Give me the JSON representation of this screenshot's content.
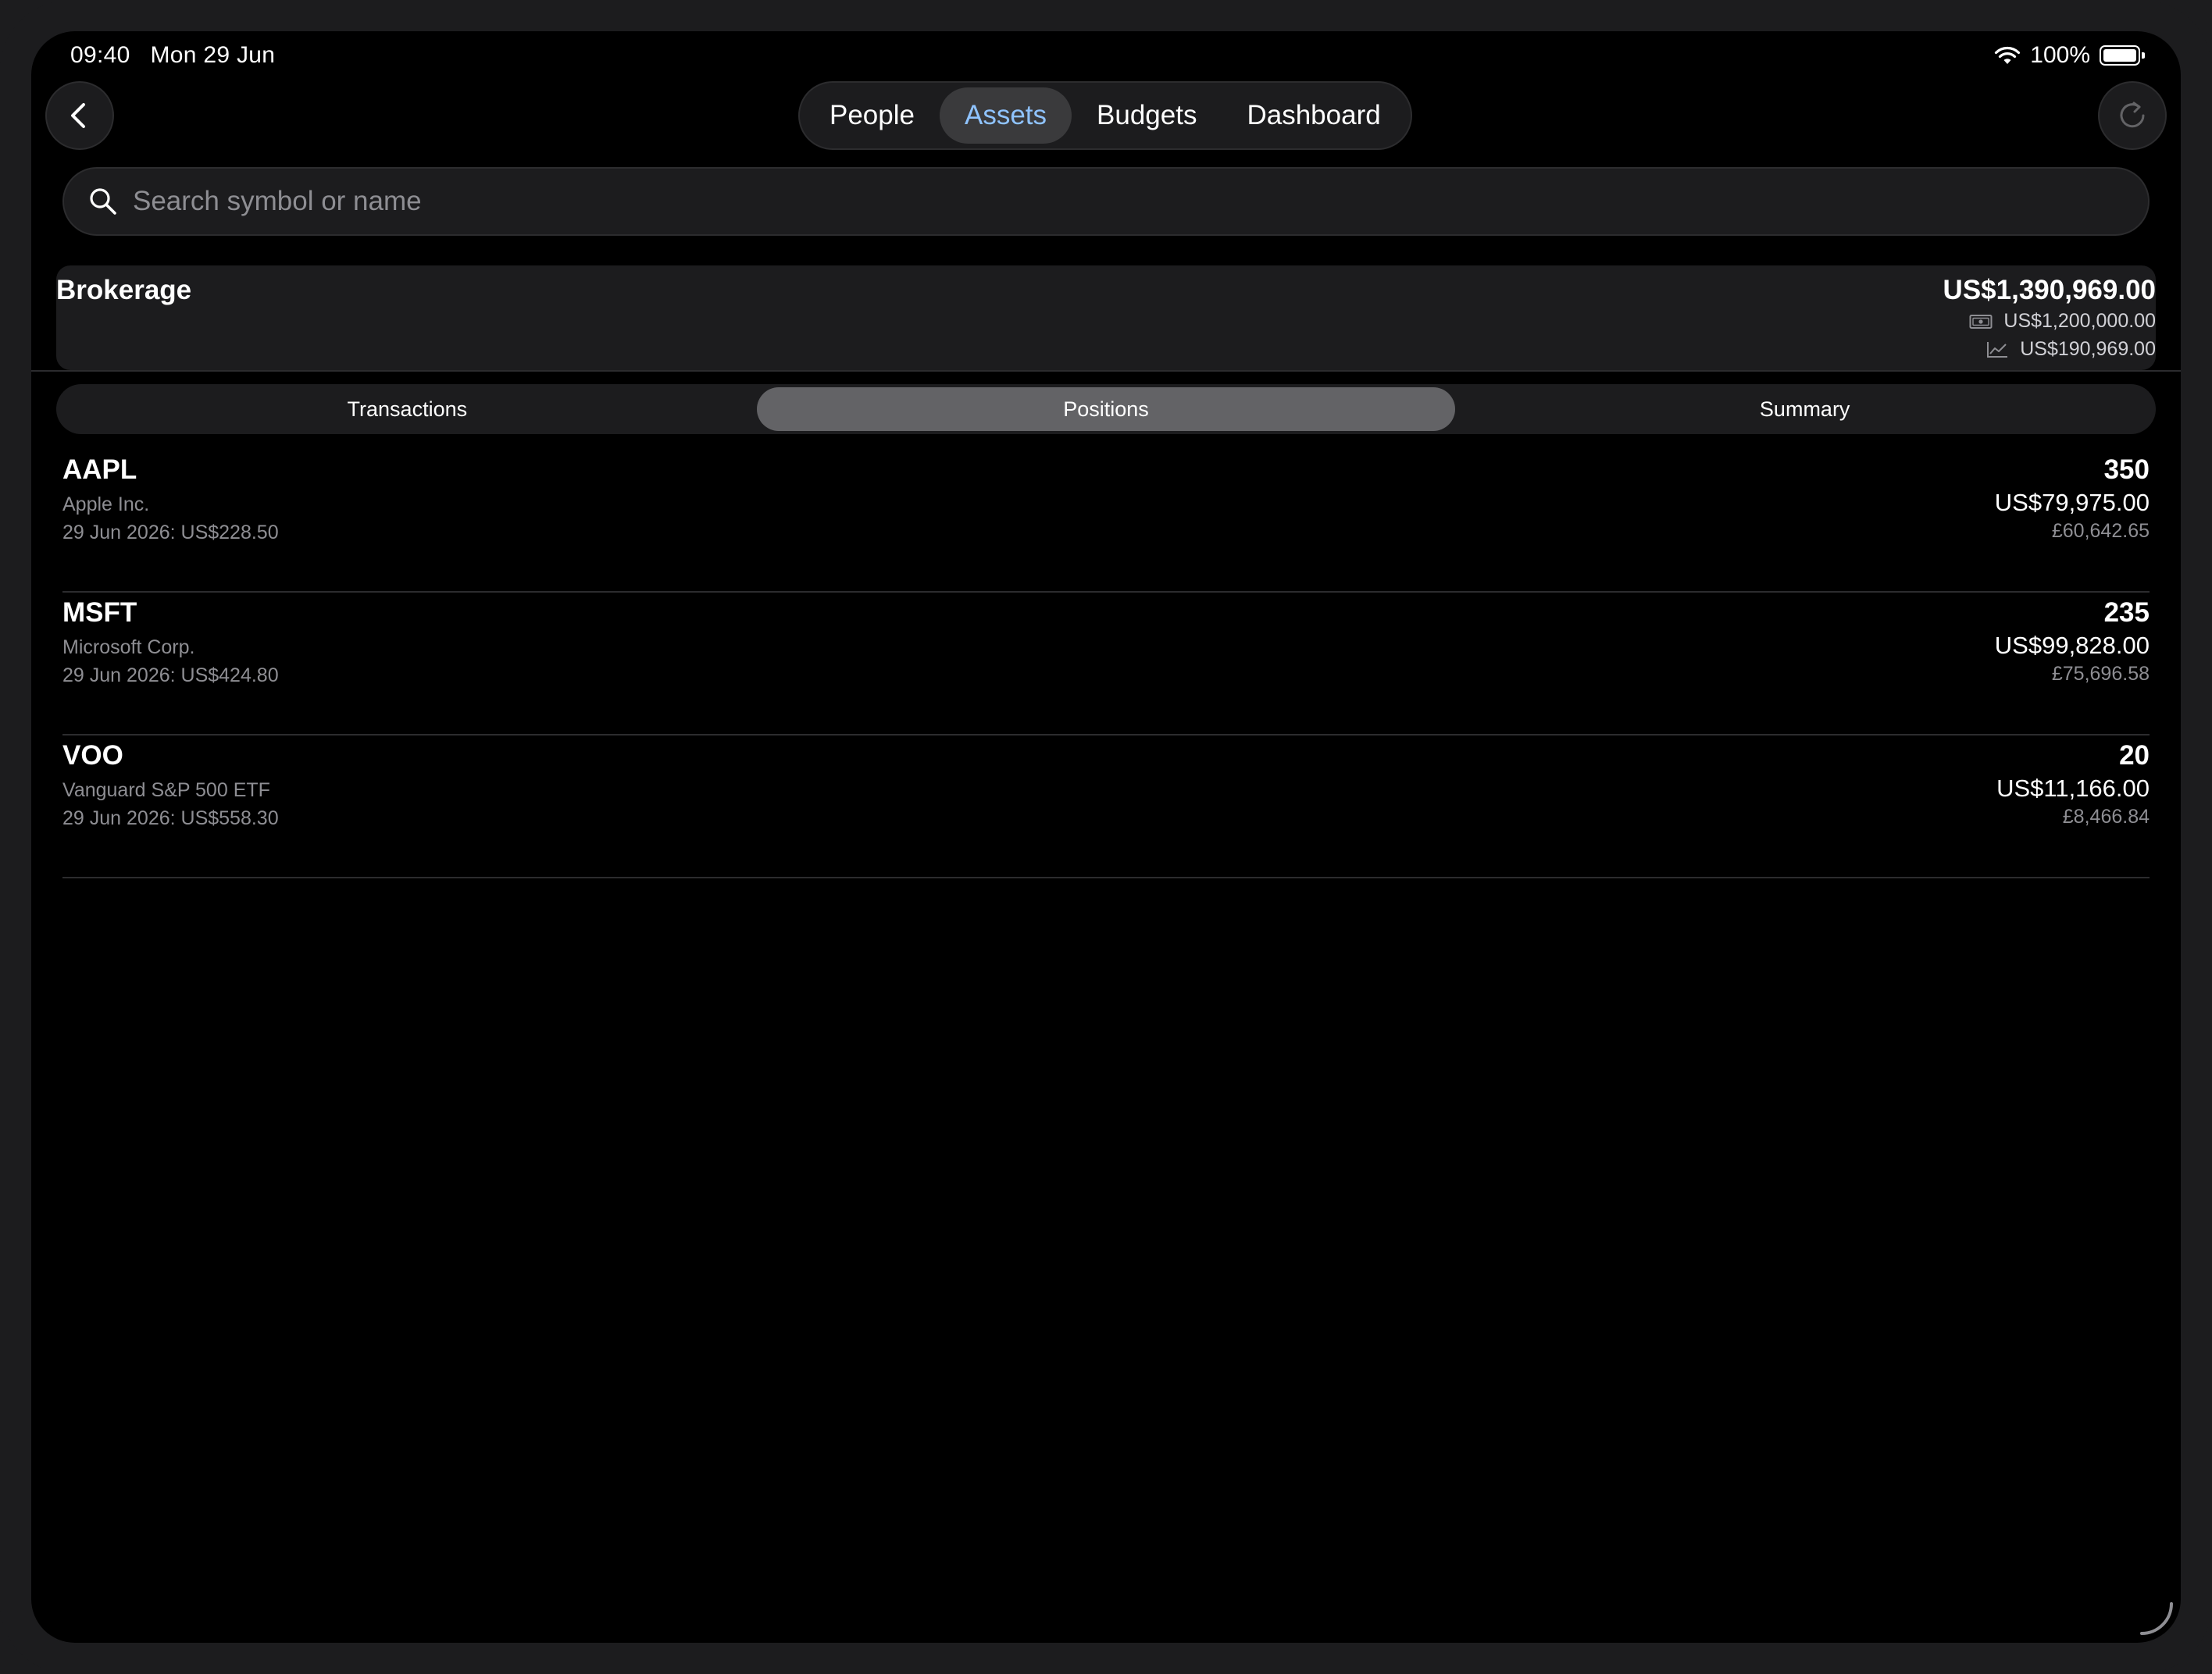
{
  "status_bar": {
    "time": "09:40",
    "date": "Mon 29 Jun",
    "battery": "100%"
  },
  "nav": {
    "tabs": [
      {
        "label": "People",
        "active": false
      },
      {
        "label": "Assets",
        "active": true
      },
      {
        "label": "Budgets",
        "active": false
      },
      {
        "label": "Dashboard",
        "active": false
      }
    ]
  },
  "search": {
    "placeholder": "Search symbol or name",
    "value": ""
  },
  "account": {
    "name": "Brokerage",
    "total": "US$1,390,969.00",
    "cash": "US$1,200,000.00",
    "gain": "US$190,969.00"
  },
  "sub_tabs": [
    {
      "label": "Transactions",
      "active": false
    },
    {
      "label": "Positions",
      "active": true
    },
    {
      "label": "Summary",
      "active": false
    }
  ],
  "positions": [
    {
      "symbol": "AAPL",
      "name": "Apple Inc.",
      "price_line": "29 Jun 2026:  US$228.50",
      "quantity": "350",
      "value_usd": "US$79,975.00",
      "value_gbp": "£60,642.65"
    },
    {
      "symbol": "MSFT",
      "name": "Microsoft Corp.",
      "price_line": "29 Jun 2026:  US$424.80",
      "quantity": "235",
      "value_usd": "US$99,828.00",
      "value_gbp": "£75,696.58"
    },
    {
      "symbol": "VOO",
      "name": "Vanguard S&P 500 ETF",
      "price_line": "29 Jun 2026:  US$558.30",
      "quantity": "20",
      "value_usd": "US$11,166.00",
      "value_gbp": "£8,466.84"
    }
  ],
  "colors": {
    "accent": "#8fc3ff",
    "background": "#000000",
    "surface": "#1c1c1e",
    "selected_segment": "#636366"
  }
}
